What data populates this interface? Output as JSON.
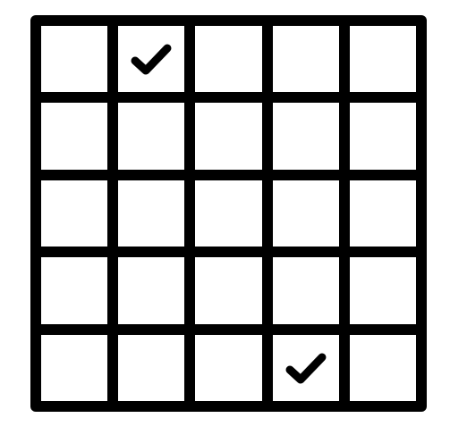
{
  "board": {
    "rows": 5,
    "cols": 5,
    "line_color": "#000000",
    "cell_color": "#ffffff",
    "mark_icon": "check-icon",
    "cells": [
      [
        false,
        true,
        false,
        false,
        false
      ],
      [
        false,
        false,
        false,
        false,
        false
      ],
      [
        false,
        false,
        false,
        false,
        false
      ],
      [
        false,
        false,
        false,
        false,
        false
      ],
      [
        false,
        false,
        false,
        true,
        false
      ]
    ]
  }
}
